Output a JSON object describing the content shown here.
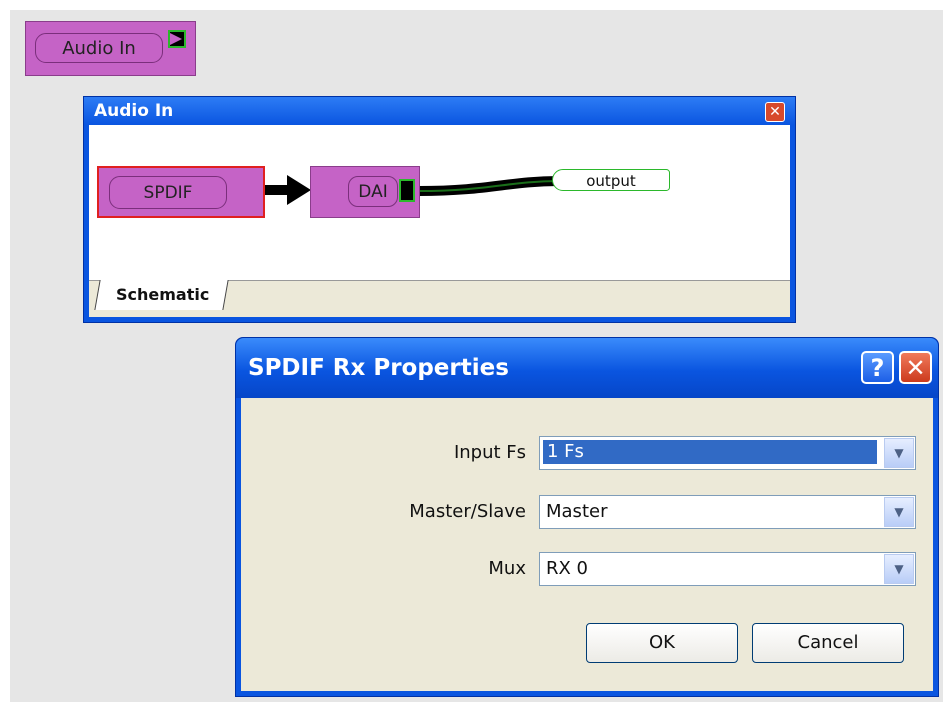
{
  "top_block": {
    "label": "Audio In"
  },
  "audio_window": {
    "title": "Audio In",
    "close_glyph": "✕",
    "blocks": {
      "spdif": "SPDIF",
      "dai": "DAI",
      "output": "output"
    },
    "tab": "Schematic"
  },
  "dialog": {
    "title": "SPDIF Rx Properties",
    "help_glyph": "?",
    "close_glyph": "✕",
    "fields": [
      {
        "label": "Input Fs",
        "value": "1 Fs"
      },
      {
        "label": "Master/Slave",
        "value": "Master"
      },
      {
        "label": "Mux",
        "value": "RX 0"
      }
    ],
    "dropdown_glyph": "▼",
    "ok_label": "OK",
    "cancel_label": "Cancel"
  },
  "colors": {
    "block": "#c563c6",
    "title_blue": "#0a55e0",
    "dialog_bg": "#ece9d8"
  }
}
